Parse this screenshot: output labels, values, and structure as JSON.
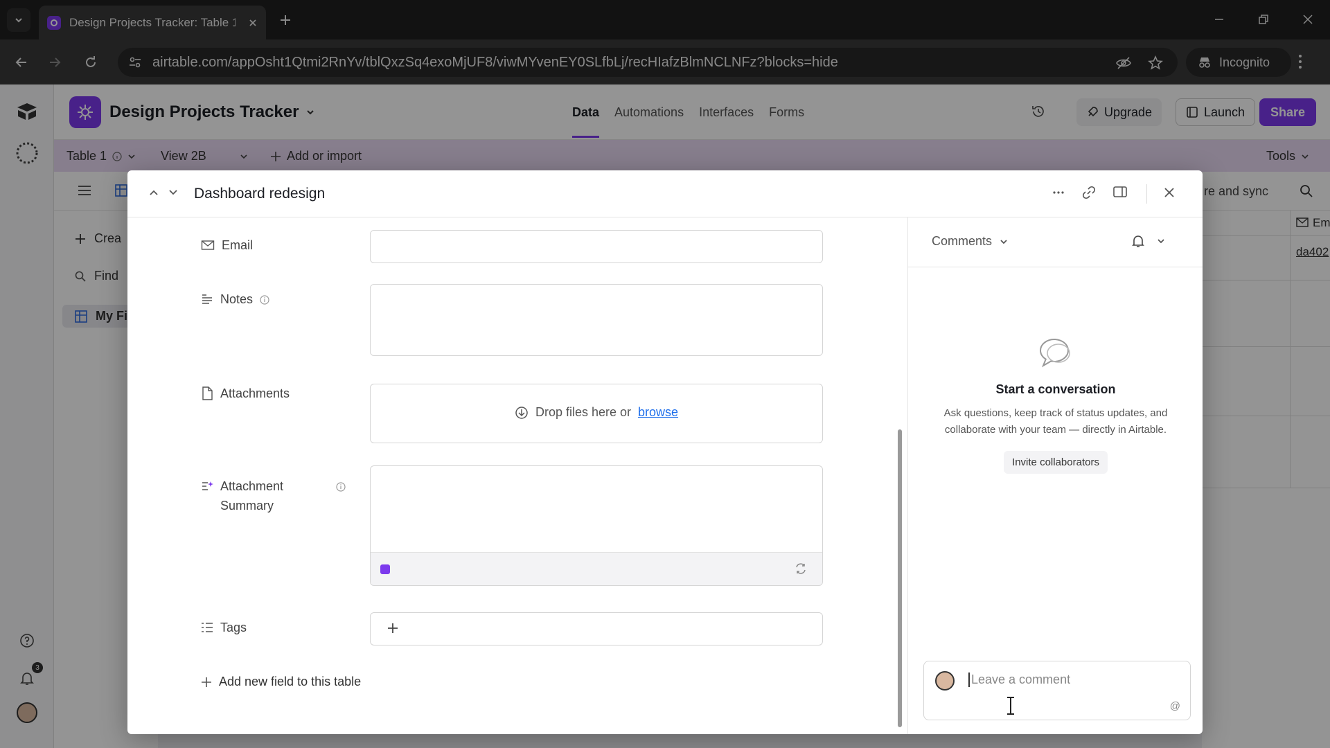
{
  "browser": {
    "tab_title": "Design Projects Tracker: Table 1",
    "url": "airtable.com/appOsht1Qtmi2RnYv/tblQxzSq4exoMjUF8/viwMYvenEY0SLfbLj/recHIafzBlmNCLNFz?blocks=hide",
    "profile_label": "Incognito"
  },
  "app": {
    "base_title": "Design Projects Tracker",
    "nav": [
      "Data",
      "Automations",
      "Interfaces",
      "Forms"
    ],
    "upgrade_label": "Upgrade",
    "launch_label": "Launch",
    "share_label": "Share",
    "table_name": "Table 1",
    "view_name": "View 2B",
    "add_import_label": "Add or import",
    "tools_label": "Tools",
    "sidebar_create": "Crea",
    "sidebar_find": "Find",
    "sidebar_my": "My Fi",
    "viewbar_right": "re and sync",
    "grid_header_partial": "Em",
    "grid_cell_link": "da402",
    "notification_count": "3"
  },
  "record": {
    "title": "Dashboard redesign",
    "fields": {
      "email_label": "Email",
      "notes_label": "Notes",
      "attachments_label": "Attachments",
      "drop_text": "Drop files here or",
      "browse_text": "browse",
      "summary_label_1": "Attachment",
      "summary_label_2": "Summary",
      "tags_label": "Tags"
    },
    "add_field_label": "Add new field to this table"
  },
  "comments": {
    "header": "Comments",
    "empty_title": "Start a conversation",
    "empty_desc": "Ask questions, keep track of status updates, and collaborate with your team — directly in Airtable.",
    "invite_label": "Invite collaborators",
    "input_placeholder": "Leave a comment",
    "mention_symbol": "@"
  }
}
